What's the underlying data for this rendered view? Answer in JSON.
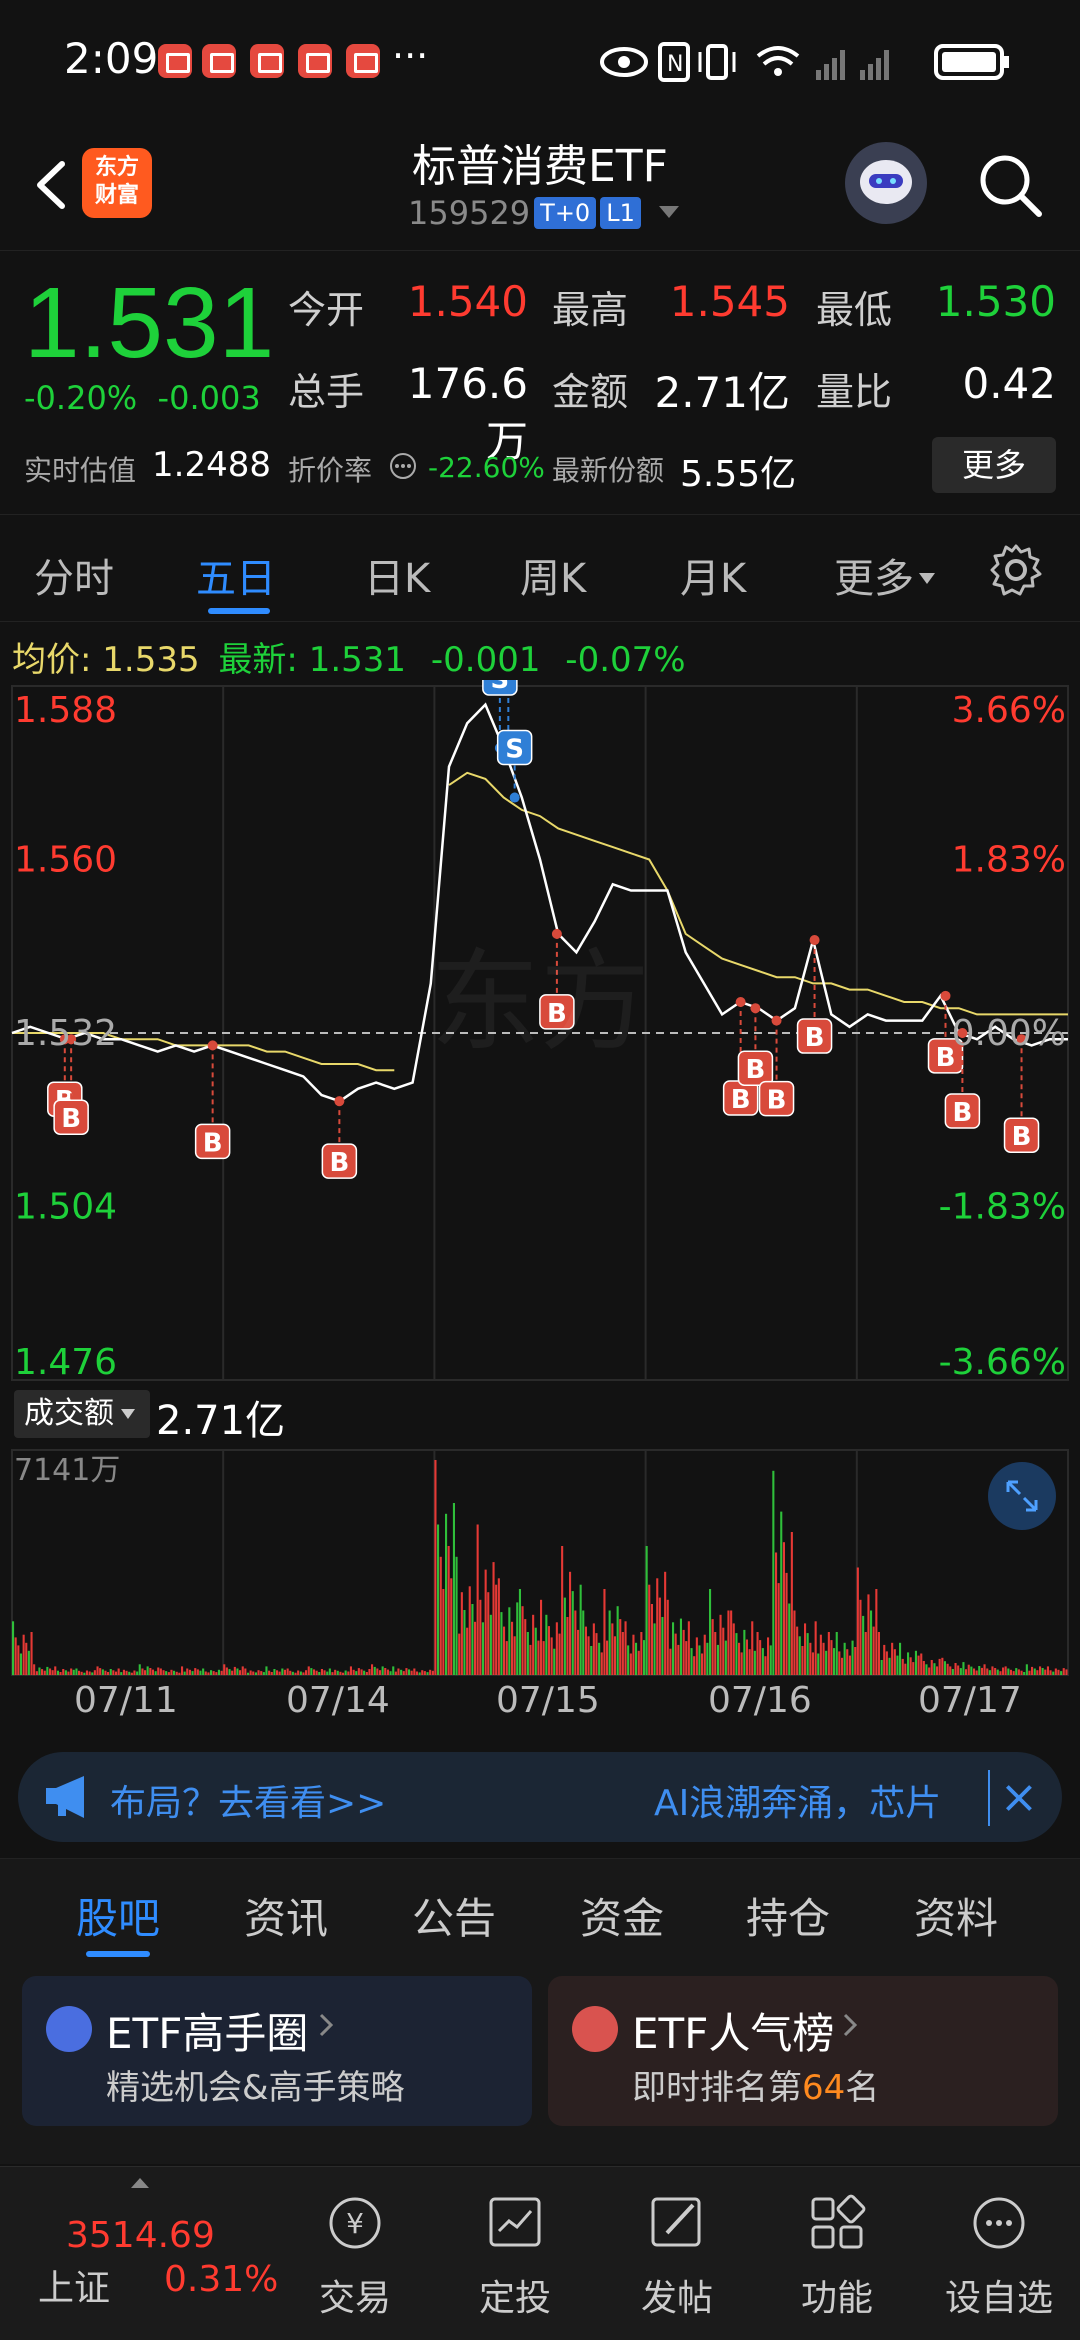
{
  "status_bar": {
    "time": "2:09",
    "dots": "···"
  },
  "header": {
    "logo_text_1": "东方",
    "logo_text_2": "财富",
    "title": "标普消费ETF",
    "code": "159529",
    "tag_t0": "T+0",
    "tag_l1": "L1"
  },
  "quote": {
    "price": "1.531",
    "change_pct": "-0.20%",
    "change_abs": "-0.003",
    "open_label": "今开",
    "open": "1.540",
    "high_label": "最高",
    "high": "1.545",
    "low_label": "最低",
    "low": "1.530",
    "volume_label": "总手",
    "volume": "176.6万",
    "amount_label": "金额",
    "amount": "2.71亿",
    "ratio_label": "量比",
    "ratio": "0.42",
    "iopv_label": "实时估值",
    "iopv": "1.2488",
    "discount_label": "折价率",
    "discount": "-22.60%",
    "shares_label": "最新份额",
    "shares": "5.55亿",
    "more_button": "更多"
  },
  "period_tabs": [
    "分时",
    "五日",
    "日K",
    "周K",
    "月K",
    "更多"
  ],
  "active_period": "五日",
  "avg_bar": {
    "avg_label": "均价:",
    "avg_value": "1.535",
    "latest_label": "最新:",
    "latest_value": "1.531",
    "diff": "-0.001",
    "diff_pct": "-0.07%"
  },
  "chart_data": {
    "type": "line",
    "y_labels_left": [
      "1.588",
      "1.560",
      "1.532",
      "1.504",
      "1.476"
    ],
    "y_labels_right": [
      "3.66%",
      "1.83%",
      "0.00%",
      "-1.83%",
      "-3.66%"
    ],
    "ylim": [
      1.476,
      1.588
    ],
    "days": [
      "07/11",
      "07/14",
      "07/15",
      "07/16",
      "07/17"
    ],
    "series": [
      {
        "values": [
          1.532,
          1.533,
          1.532,
          1.531,
          1.532,
          1.531,
          1.531,
          1.53,
          1.529,
          1.53,
          1.529,
          1.53,
          1.529,
          1.528,
          1.527,
          1.526,
          1.525,
          1.522,
          1.521,
          1.523,
          1.524,
          1.523,
          1.524,
          1.54,
          1.575,
          1.582,
          1.585,
          1.578,
          1.57,
          1.56,
          1.548,
          1.545,
          1.55,
          1.556,
          1.555,
          1.555,
          1.555,
          1.545,
          1.54,
          1.535,
          1.537,
          1.536,
          1.534,
          1.536,
          1.547,
          1.535,
          1.533,
          1.535,
          1.534,
          1.534,
          1.534,
          1.538,
          1.532,
          1.531,
          1.533,
          1.531,
          1.53,
          1.531,
          1.531
        ]
      },
      {
        "values": [
          1.532,
          1.532,
          1.532,
          1.532,
          1.532,
          1.532,
          1.531,
          1.531,
          1.531,
          1.53,
          1.53,
          1.53,
          1.53,
          1.53,
          1.529,
          1.529,
          1.528,
          1.527,
          1.527,
          1.527,
          1.526,
          1.526,
          null,
          null,
          1.572,
          1.574,
          1.573,
          1.57,
          1.568,
          1.567,
          1.565,
          1.564,
          1.563,
          1.562,
          1.561,
          1.56,
          1.555,
          1.548,
          1.546,
          1.544,
          1.543,
          1.542,
          1.541,
          1.541,
          1.54,
          1.54,
          1.539,
          1.539,
          1.538,
          1.537,
          1.537,
          1.536,
          1.536,
          1.535,
          1.535,
          1.535,
          1.535,
          1.535,
          1.535
        ]
      }
    ],
    "trade_markers": [
      {
        "type": "B",
        "day_idx": 0,
        "pos": 0.25
      },
      {
        "type": "B",
        "day_idx": 0,
        "pos": 0.28
      },
      {
        "type": "B",
        "day_idx": 0,
        "pos": 0.95
      },
      {
        "type": "B",
        "day_idx": 1,
        "pos": 0.55
      },
      {
        "type": "S",
        "day_idx": 2,
        "pos": 0.31
      },
      {
        "type": "S",
        "day_idx": 2,
        "pos": 0.35
      },
      {
        "type": "S",
        "day_idx": 2,
        "pos": 0.38
      },
      {
        "type": "B",
        "day_idx": 2,
        "pos": 0.58
      },
      {
        "type": "B",
        "day_idx": 3,
        "pos": 0.45
      },
      {
        "type": "B",
        "day_idx": 3,
        "pos": 0.52
      },
      {
        "type": "B",
        "day_idx": 3,
        "pos": 0.62
      },
      {
        "type": "B",
        "day_idx": 3,
        "pos": 0.8
      },
      {
        "type": "B",
        "day_idx": 4,
        "pos": 0.42
      },
      {
        "type": "B",
        "day_idx": 4,
        "pos": 0.5
      },
      {
        "type": "B",
        "day_idx": 4,
        "pos": 0.78
      }
    ],
    "volume_max_label": "7141万",
    "volume": [
      0.25,
      0.05,
      0.04,
      0.03,
      0.04,
      0.03,
      0.05,
      0.03,
      0.04,
      0.03,
      0.05,
      0.03,
      0.04,
      0.03,
      0.04,
      0.03,
      0.04,
      0.05,
      0.04,
      0.03,
      1.0,
      0.55,
      0.7,
      0.45,
      0.4,
      0.35,
      0.6,
      0.3,
      0.4,
      0.25,
      0.6,
      0.35,
      0.25,
      0.4,
      0.3,
      0.25,
      0.95,
      0.3,
      0.25,
      0.2,
      0.5,
      0.2,
      0.15,
      0.1,
      0.08,
      0.06,
      0.05,
      0.04,
      0.05,
      0.04
    ],
    "volume_selector": "成交额",
    "volume_total": "2.71亿",
    "colors": {
      "price_line": "#ffffff",
      "avg_line": "#e8d86a",
      "up": "#e53935",
      "down": "#2fbf3a",
      "buy": "#d84a3b",
      "sell": "#2f7fd6"
    }
  },
  "ticker": {
    "left_text": "布局？去看看>>",
    "right_text": "AI浪潮奔涌，芯片"
  },
  "sub_tabs": [
    "股吧",
    "资讯",
    "公告",
    "资金",
    "持仓",
    "资料"
  ],
  "active_sub_tab": "股吧",
  "cards": [
    {
      "title": "ETF高手圈",
      "subtitle": "精选机会&高手策略"
    },
    {
      "title": "ETF人气榜",
      "subtitle_prefix": "即时排名第",
      "rank": "64",
      "subtitle_suffix": "名"
    }
  ],
  "bottom_nav": {
    "index_value": "3514.69",
    "index_name": "上证",
    "index_pct": "0.31%",
    "items": [
      "交易",
      "定投",
      "发帖",
      "功能",
      "设自选"
    ]
  }
}
